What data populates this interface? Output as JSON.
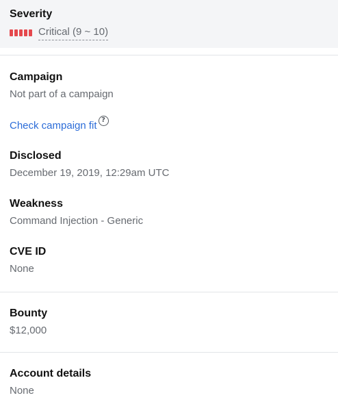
{
  "severity": {
    "label": "Severity",
    "value": "Critical (9 ~ 10)",
    "color": "#e5484d"
  },
  "campaign": {
    "label": "Campaign",
    "value": "Not part of a campaign",
    "link": "Check campaign fit",
    "help_icon": "?"
  },
  "disclosed": {
    "label": "Disclosed",
    "value": "December 19, 2019, 12:29am UTC"
  },
  "weakness": {
    "label": "Weakness",
    "value": "Command Injection - Generic"
  },
  "cve": {
    "label": "CVE ID",
    "value": "None"
  },
  "bounty": {
    "label": "Bounty",
    "value": "$12,000"
  },
  "account": {
    "label": "Account details",
    "value": "None"
  }
}
